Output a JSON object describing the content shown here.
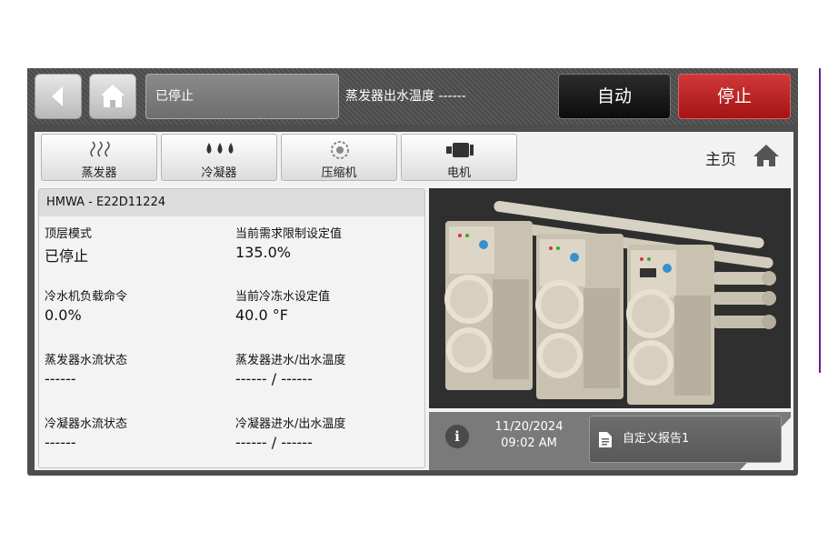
{
  "header": {
    "status_text": "已停止",
    "evap_leaving_label": "蒸发器出水温度 ------",
    "auto_label": "自动",
    "stop_label": "停止"
  },
  "tabs": [
    {
      "label": "蒸发器",
      "icon": "evaporator-icon"
    },
    {
      "label": "冷凝器",
      "icon": "condenser-icon"
    },
    {
      "label": "压缩机",
      "icon": "compressor-icon"
    },
    {
      "label": "电机",
      "icon": "motor-icon"
    }
  ],
  "home_link": {
    "label": "主页",
    "icon": "home-icon"
  },
  "unit": {
    "model": "HMWA - E22D11224",
    "fields": [
      {
        "title": "顶层模式",
        "value": "已停止"
      },
      {
        "title": "当前需求限制设定值",
        "value": "135.0%"
      },
      {
        "title": "冷水机负载命令",
        "value": "0.0%"
      },
      {
        "title": "当前冷冻水设定值",
        "value": "40.0 °F"
      },
      {
        "title": "蒸发器水流状态",
        "value": "------"
      },
      {
        "title": "蒸发器进水/出水温度",
        "value": "------ / ------"
      },
      {
        "title": "冷凝器水流状态",
        "value": "------"
      },
      {
        "title": "冷凝器进水/出水温度",
        "value": "------ / ------"
      }
    ]
  },
  "footer": {
    "date": "11/20/2024",
    "time": "09:02 AM",
    "report_label": "自定义报告1",
    "info_icon": "info-icon",
    "report_icon": "document-icon"
  },
  "colors": {
    "stop_button": "#b82020",
    "auto_button": "#1a1a1a",
    "frame": "#4d4d4d",
    "accent_line": "#6a1f8c"
  }
}
